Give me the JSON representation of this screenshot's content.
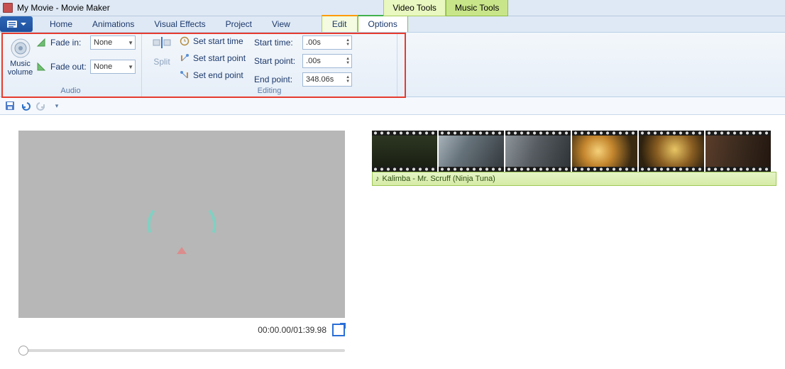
{
  "title": "My Movie - Movie Maker",
  "context_tabs": {
    "video": "Video Tools",
    "music": "Music Tools"
  },
  "tabs": {
    "home": "Home",
    "animations": "Animations",
    "visual_effects": "Visual Effects",
    "project": "Project",
    "view": "View",
    "edit": "Edit",
    "options": "Options"
  },
  "ribbon": {
    "audio": {
      "group_label": "Audio",
      "music_volume": "Music volume",
      "fade_in_label": "Fade in:",
      "fade_in_value": "None",
      "fade_out_label": "Fade out:",
      "fade_out_value": "None",
      "split": "Split"
    },
    "editing": {
      "group_label": "Editing",
      "set_start_time": "Set start time",
      "set_start_point": "Set start point",
      "set_end_point": "Set end point",
      "start_time_label": "Start time:",
      "start_time_value": ".00s",
      "start_point_label": "Start point:",
      "start_point_value": ".00s",
      "end_point_label": "End point:",
      "end_point_value": "348.06s"
    }
  },
  "preview": {
    "timecode": "00:00.00/01:39.98"
  },
  "timeline": {
    "audio_clip": "Kalimba - Mr. Scruff (Ninja Tuna)"
  }
}
